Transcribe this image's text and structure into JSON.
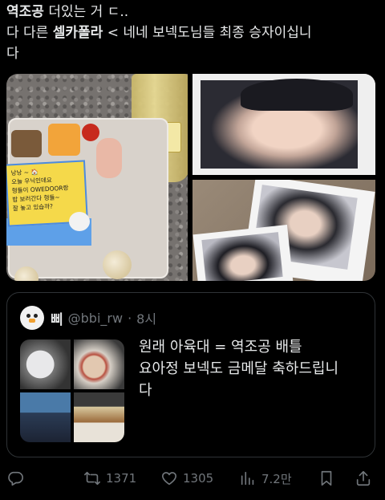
{
  "post": {
    "lines": [
      {
        "bold": "역조공",
        "rest": " 더있는 거 ㄷ.."
      },
      {
        "prefix": "다 다른 ",
        "bold": "셀카폴라",
        "rest": " < 네네 보넥도님들 최종 승자이십니"
      },
      {
        "rest": "다"
      }
    ]
  },
  "media": {
    "note_lines": [
      "낭낭 ~ 🏠",
      "오늘 우닉인데요",
      "형들이 OWEDOOR랑",
      "밥 보러간다 형들~",
      "잘 놓고 있습까?"
    ]
  },
  "quote": {
    "display_name": "삐",
    "handle": "@bbi_rw",
    "separator": "·",
    "time": "8시",
    "text_lines": [
      "원래 아육대 = 역조공 배틀",
      "요아정 보넥도 금메달 축하드립니",
      "다"
    ]
  },
  "actions": {
    "reply_icon": "reply-icon",
    "retweet_count": "1371",
    "like_count": "1305",
    "views_count": "7.2만",
    "bookmark_icon": "bookmark-icon",
    "share_icon": "share-icon"
  },
  "colors": {
    "background": "#000000",
    "text": "#e7e9ea",
    "muted": "#71767b",
    "border": "#2f3336"
  }
}
